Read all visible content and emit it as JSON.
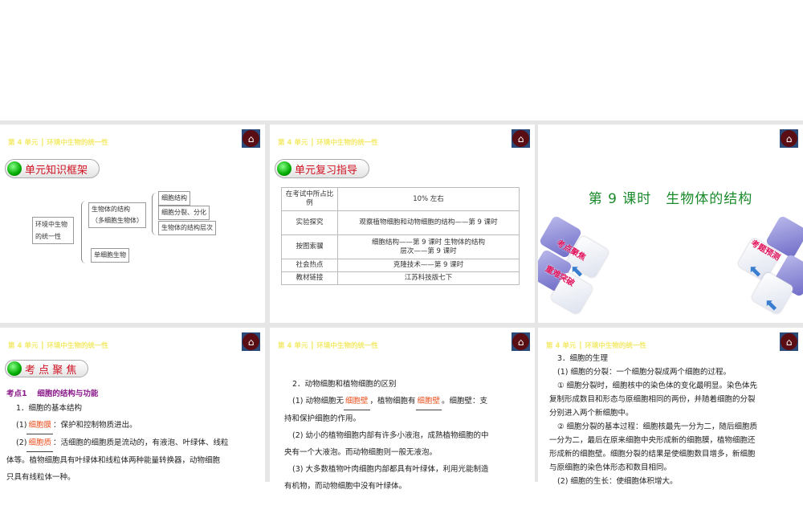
{
  "header": "第 4 单元 ┃ 环境中生物的统一性",
  "home_icon": "home-icon",
  "slide1": {
    "pill": "单元知识框架",
    "root": "环境中生物的统一性",
    "root_l1": "环境中生物",
    "root_l2": "的统一性",
    "multi_l1": "生物体的结构",
    "multi_l2": "（多细胞生物体）",
    "leaf1": "细胞结构",
    "leaf2": "细胞分裂、分化",
    "leaf3": "生物体的结构层次",
    "single": "单细胞生物"
  },
  "slide2": {
    "pill": "单元复习指导",
    "rows": [
      {
        "k": "在考试中所占比例",
        "v": "10% 左右"
      },
      {
        "k": "实验探究",
        "v": "观察植物细胞和动物细胞的结构——第 9 课时"
      },
      {
        "k": "按图索骥",
        "v": "细胞结构——第 9 课时 生物体的结构层次——第 9 课时"
      },
      {
        "k": "社会热点",
        "v": "克隆技术——第 9 课时"
      },
      {
        "k": "教材链接",
        "v": "江苏科技版七下"
      }
    ]
  },
  "slide3": {
    "title": "第 9 课时　生物体的结构",
    "tiles": [
      "考点聚焦",
      "重难突破",
      "考题预测"
    ]
  },
  "slide4": {
    "pill": "考 点 聚 焦",
    "subtitle": "考点1　 细胞的结构与功能",
    "l1": "1．细胞的基本结构",
    "l2a": "(1)",
    "l2fill": "细胞膜",
    "l2b": "：保护和控制物质进出。",
    "l3a": "(2)",
    "l3fill": "细胞质",
    "l3b": "：活细胞的细胞质是流动的，有液泡、叶绿体、线粒",
    "l4": "体等。植物细胞具有叶绿体和线粒体两种能量转换器，动物细胞",
    "l5": "只具有线粒体一种。"
  },
  "slide5": {
    "l1": "2．动物细胞和植物细胞的区别",
    "l2a": "(1) 动物细胞无",
    "fill1": "细胞壁",
    "l2b": "，植物细胞有",
    "fill2": "细胞壁",
    "l2c": "。细胞壁：支",
    "l3": "持和保护细胞的作用。",
    "l4": "(2) 幼小的植物细胞内部有许多小液泡，成熟植物细胞的中",
    "l5": "央有一个大液泡。而动物细胞则一般无液泡。",
    "l6": "(3) 大多数植物叶肉细胞内部都具有叶绿体，利用光能制造",
    "l7": "有机物，而动物细胞中没有叶绿体。"
  },
  "slide6": {
    "l1": "3．细胞的生理",
    "l2": "(1) 细胞的分裂：一个细胞分裂成两个细胞的过程。",
    "l3": "① 细胞分裂时，细胞核中的染色体的变化最明显。染色体先",
    "l4": "复制形成数目和形态与原细胞相同的两份，并随着细胞的分裂",
    "l5": "分别进入两个新细胞中。",
    "l6": "② 细胞分裂的基本过程：细胞核最先一分为二，随后细胞质",
    "l7": "一分为二，最后在原来细胞中央形成新的细胞膜，植物细胞还",
    "l8": "形成新的细胞壁。细胞分裂的结果是使细胞数目增多，新细胞",
    "l9": "与原细胞的染色体形态和数目相同。",
    "l10": "(2) 细胞的生长：使细胞体积增大。"
  }
}
